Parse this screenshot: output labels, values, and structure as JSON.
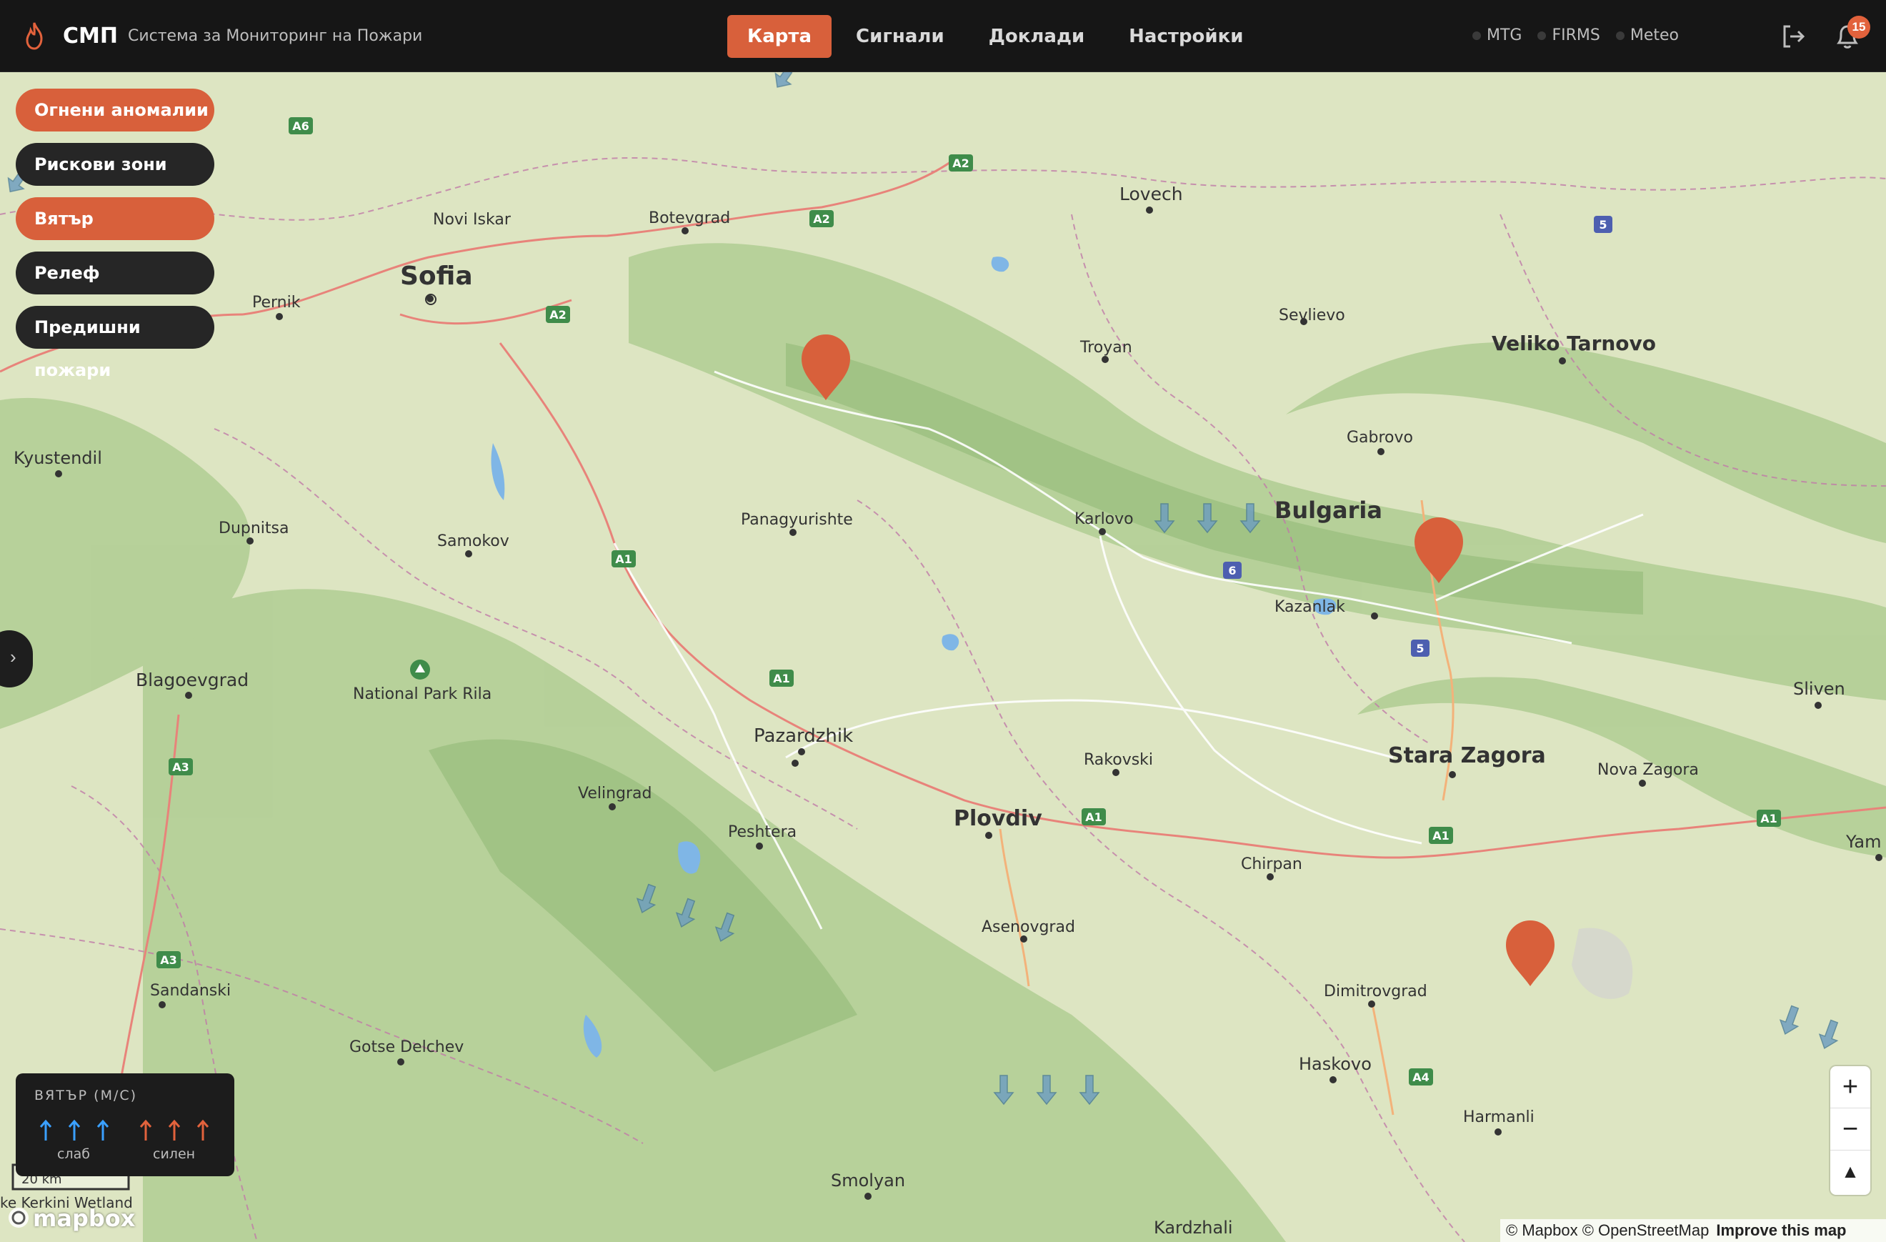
{
  "header": {
    "brand_abbr": "СМП",
    "brand_full": "Система за Мониторинг на Пожари",
    "nav": [
      {
        "label": "Карта",
        "active": true
      },
      {
        "label": "Сигнали",
        "active": false
      },
      {
        "label": "Доклади",
        "active": false
      },
      {
        "label": "Настройки",
        "active": false
      }
    ],
    "sources": [
      "MTG",
      "FIRMS",
      "Meteo"
    ],
    "notifications_count": "15",
    "accent": "#d8603b"
  },
  "layers": [
    {
      "label": "Огнени аномалии",
      "active": true
    },
    {
      "label": "Рискови зони",
      "active": false
    },
    {
      "label": "Вятър",
      "active": true
    },
    {
      "label": "Релеф",
      "active": false
    },
    {
      "label": "Предишни пожари",
      "active": false
    }
  ],
  "legend": {
    "title": "ВЯТЪР (М/С)",
    "weak_label": "слаб",
    "strong_label": "силен",
    "weak_color": "#3aa0ff",
    "strong_color": "#e2623c"
  },
  "map": {
    "country": "Bulgaria",
    "cities": [
      {
        "name": "Sofia",
        "major": true
      },
      {
        "name": "Plovdiv",
        "major": true
      },
      {
        "name": "Stara Zagora",
        "major": true
      },
      {
        "name": "Veliko Tarnovo",
        "major": true
      },
      {
        "name": "Pernik"
      },
      {
        "name": "Novi Iskar"
      },
      {
        "name": "Botevgrad"
      },
      {
        "name": "Lovech"
      },
      {
        "name": "Troyan"
      },
      {
        "name": "Sevlievo"
      },
      {
        "name": "Gabrovo"
      },
      {
        "name": "Kyustendil"
      },
      {
        "name": "Dupnitsa"
      },
      {
        "name": "Samokov"
      },
      {
        "name": "Panagyurishte"
      },
      {
        "name": "Karlovo"
      },
      {
        "name": "Kazanlak"
      },
      {
        "name": "Blagoevgrad"
      },
      {
        "name": "National Park Rila"
      },
      {
        "name": "Pazardzhik"
      },
      {
        "name": "Rakovski"
      },
      {
        "name": "Nova Zagora"
      },
      {
        "name": "Sliven"
      },
      {
        "name": "Velingrad"
      },
      {
        "name": "Peshtera"
      },
      {
        "name": "Chirpan"
      },
      {
        "name": "Asenovgrad"
      },
      {
        "name": "Dimitrovgrad"
      },
      {
        "name": "Haskovo"
      },
      {
        "name": "Sandanski"
      },
      {
        "name": "Gotse Delchev"
      },
      {
        "name": "Harmanli"
      },
      {
        "name": "Smolyan"
      },
      {
        "name": "Kardzhali"
      },
      {
        "name": "Yam"
      }
    ],
    "roads": [
      "A6",
      "A2",
      "A2",
      "A2",
      "A1",
      "A1",
      "A1",
      "A1",
      "A1",
      "A3",
      "A3",
      "A4",
      "5",
      "5",
      "6"
    ],
    "fire_markers": 3,
    "attribution": "© Mapbox © OpenStreetMap",
    "improve_link": "Improve this map",
    "logo_text": "mapbox",
    "scale_text": "20 km",
    "wetland_text": "ke Kerkini Wetland"
  }
}
